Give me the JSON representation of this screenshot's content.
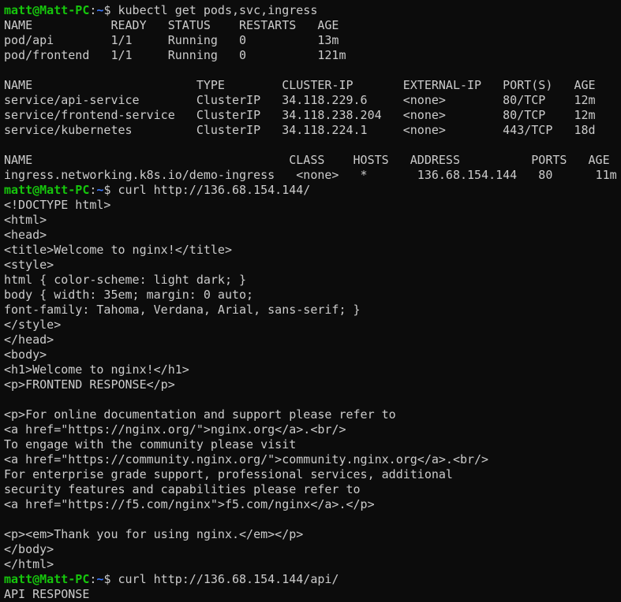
{
  "prompt": {
    "user_host": "matt@Matt-PC",
    "path": "~",
    "symbol": "$"
  },
  "colors": {
    "background": "#0c0c0c",
    "text": "#cccccc",
    "user_host": "#16c60c",
    "path": "#3b78ff"
  },
  "lines": [
    {
      "type": "prompt",
      "cmd": "kubectl get pods,svc,ingress"
    },
    {
      "type": "out",
      "text": "NAME           READY   STATUS    RESTARTS   AGE"
    },
    {
      "type": "out",
      "text": "pod/api        1/1     Running   0          13m"
    },
    {
      "type": "out",
      "text": "pod/frontend   1/1     Running   0          121m"
    },
    {
      "type": "out",
      "text": ""
    },
    {
      "type": "out",
      "text": "NAME                       TYPE        CLUSTER-IP       EXTERNAL-IP   PORT(S)   AGE"
    },
    {
      "type": "out",
      "text": "service/api-service        ClusterIP   34.118.229.6     <none>        80/TCP    12m"
    },
    {
      "type": "out",
      "text": "service/frontend-service   ClusterIP   34.118.238.204   <none>        80/TCP    12m"
    },
    {
      "type": "out",
      "text": "service/kubernetes         ClusterIP   34.118.224.1     <none>        443/TCP   18d"
    },
    {
      "type": "out",
      "text": ""
    },
    {
      "type": "out",
      "text": "NAME                                    CLASS    HOSTS   ADDRESS          PORTS   AGE"
    },
    {
      "type": "out",
      "text": "ingress.networking.k8s.io/demo-ingress   <none>   *       136.68.154.144   80      11m"
    },
    {
      "type": "prompt",
      "cmd": "curl http://136.68.154.144/"
    },
    {
      "type": "out",
      "text": "<!DOCTYPE html>"
    },
    {
      "type": "out",
      "text": "<html>"
    },
    {
      "type": "out",
      "text": "<head>"
    },
    {
      "type": "out",
      "text": "<title>Welcome to nginx!</title>"
    },
    {
      "type": "out",
      "text": "<style>"
    },
    {
      "type": "out",
      "text": "html { color-scheme: light dark; }"
    },
    {
      "type": "out",
      "text": "body { width: 35em; margin: 0 auto;"
    },
    {
      "type": "out",
      "text": "font-family: Tahoma, Verdana, Arial, sans-serif; }"
    },
    {
      "type": "out",
      "text": "</style>"
    },
    {
      "type": "out",
      "text": "</head>"
    },
    {
      "type": "out",
      "text": "<body>"
    },
    {
      "type": "out",
      "text": "<h1>Welcome to nginx!</h1>"
    },
    {
      "type": "out",
      "text": "<p>FRONTEND RESPONSE</p>"
    },
    {
      "type": "out",
      "text": ""
    },
    {
      "type": "out",
      "text": "<p>For online documentation and support please refer to"
    },
    {
      "type": "out",
      "text": "<a href=\"https://nginx.org/\">nginx.org</a>.<br/>"
    },
    {
      "type": "out",
      "text": "To engage with the community please visit"
    },
    {
      "type": "out",
      "text": "<a href=\"https://community.nginx.org/\">community.nginx.org</a>.<br/>"
    },
    {
      "type": "out",
      "text": "For enterprise grade support, professional services, additional"
    },
    {
      "type": "out",
      "text": "security features and capabilities please refer to"
    },
    {
      "type": "out",
      "text": "<a href=\"https://f5.com/nginx\">f5.com/nginx</a>.</p>"
    },
    {
      "type": "out",
      "text": ""
    },
    {
      "type": "out",
      "text": "<p><em>Thank you for using nginx.</em></p>"
    },
    {
      "type": "out",
      "text": "</body>"
    },
    {
      "type": "out",
      "text": "</html>"
    },
    {
      "type": "prompt",
      "cmd": "curl http://136.68.154.144/api/"
    },
    {
      "type": "out",
      "text": "API RESPONSE"
    }
  ]
}
